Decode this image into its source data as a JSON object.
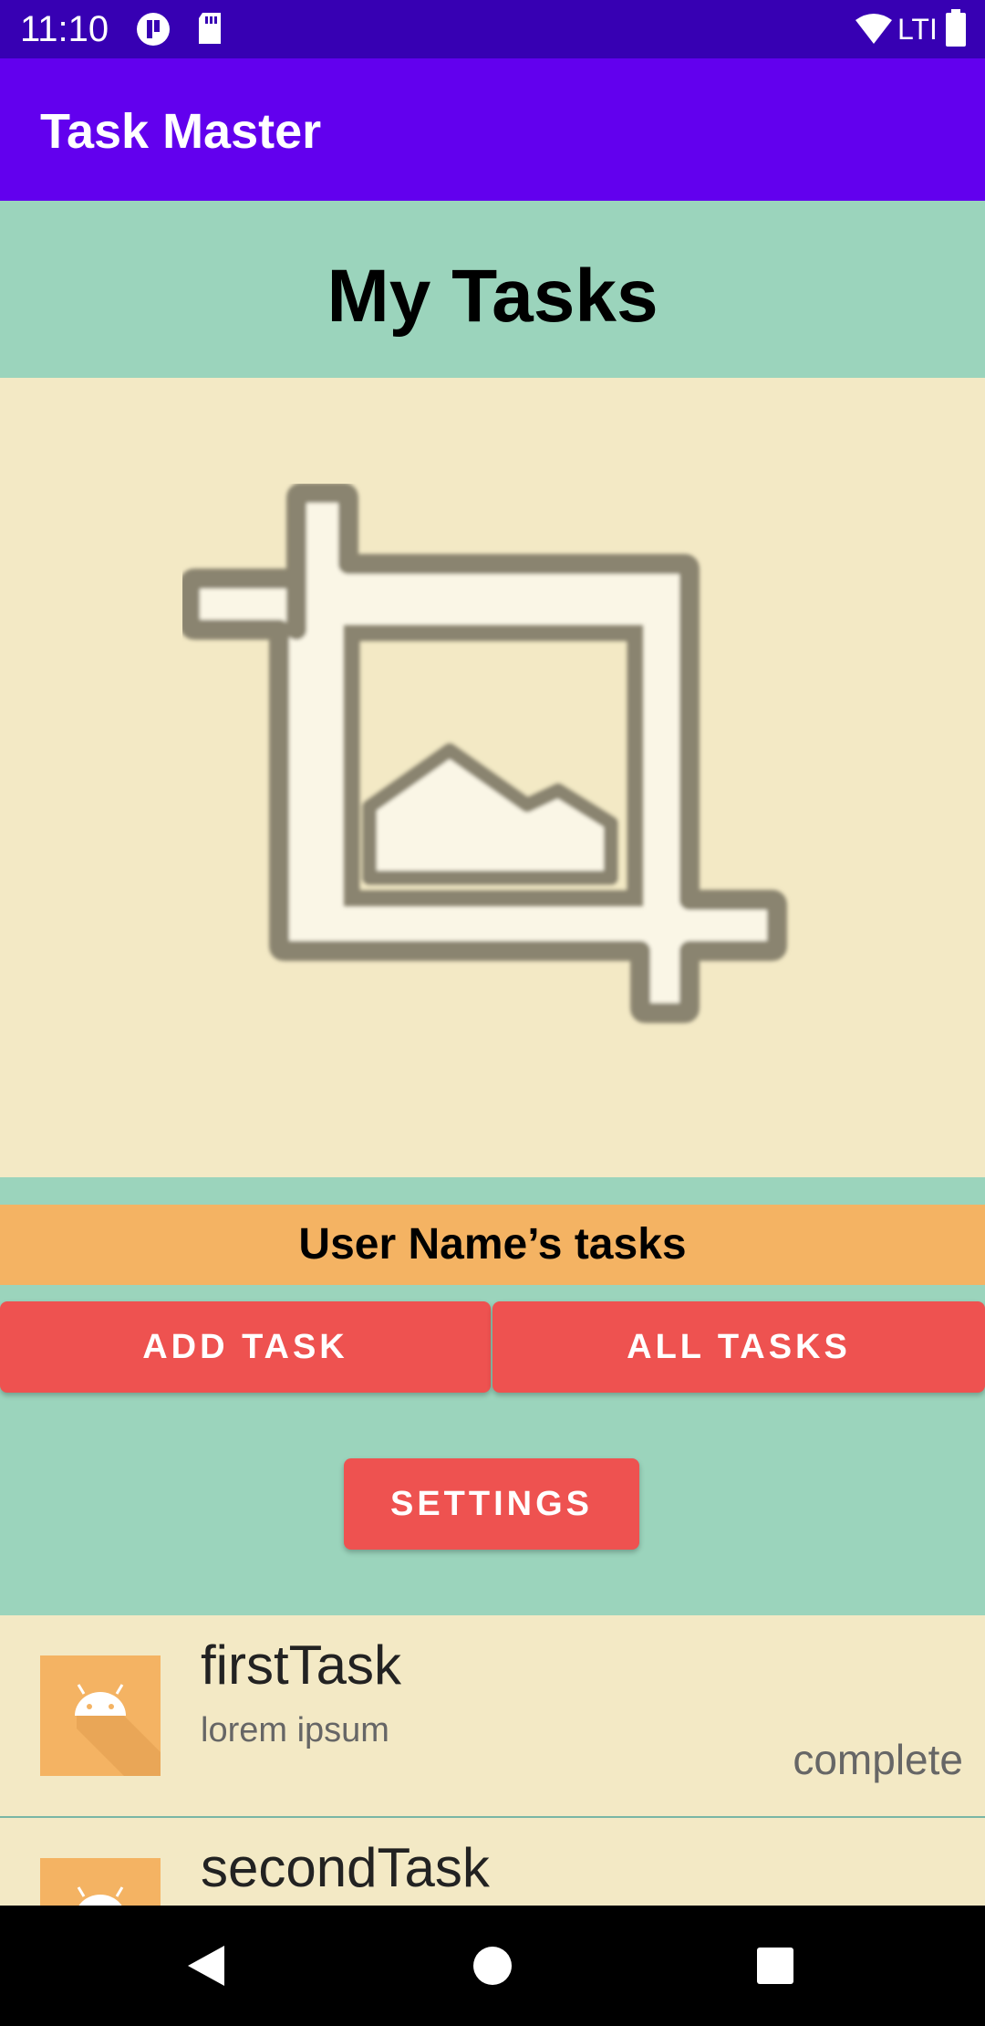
{
  "status": {
    "time": "11:10",
    "network_label": "LTI"
  },
  "appbar": {
    "title": "Task Master"
  },
  "main": {
    "heading": "My Tasks",
    "image_icon": "crop-image-icon",
    "username_tasks": "User Name’s tasks"
  },
  "buttons": {
    "add_task": "ADD TASK",
    "all_tasks": "ALL TASKS",
    "settings": "SETTINGS"
  },
  "tasks": [
    {
      "title": "firstTask",
      "body": "lorem ipsum",
      "state": "complete",
      "icon": "android-icon"
    },
    {
      "title": "secondTask",
      "icon": "android-icon"
    }
  ],
  "navbar": {
    "icons": [
      "back-icon",
      "home-icon",
      "recents-icon"
    ]
  },
  "colors": {
    "status_bar": "#3700b3",
    "app_bar": "#6200ee",
    "teal": "#9bd4bc",
    "cream": "#f3e9c5",
    "orange": "#f4b363",
    "button_red": "#ee5250"
  }
}
